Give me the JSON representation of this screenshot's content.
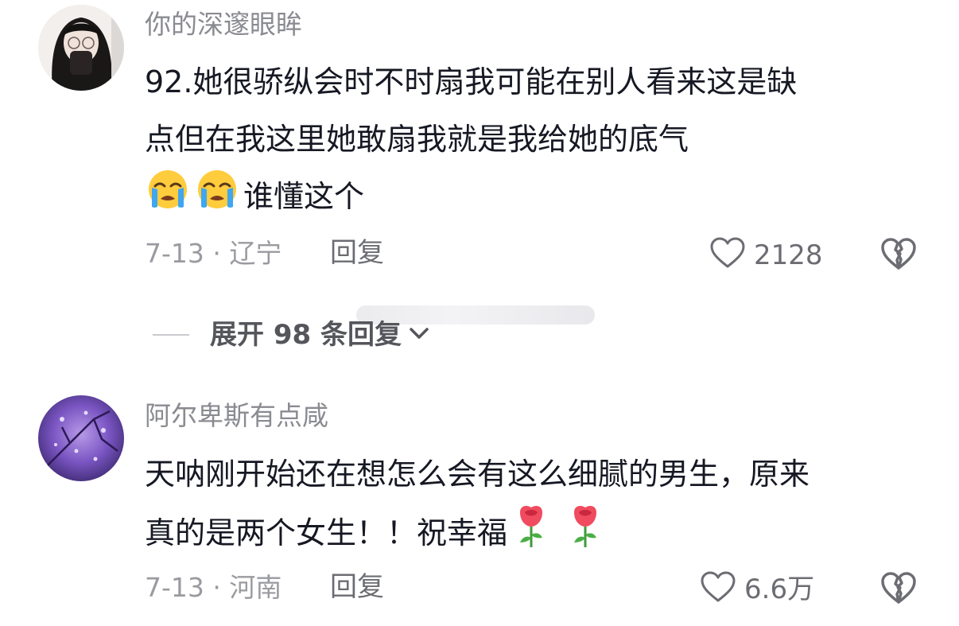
{
  "comments": [
    {
      "username": "你的深邃眼眸",
      "lines": [
        "92.她很骄纵会时不时扇我可能在别人看来这是缺",
        "点但在我这里她敢扇我就是我给她的底气"
      ],
      "emoji_line_text": "谁懂这个",
      "emoji_icons": [
        "crying-face-icon",
        "crying-face-icon"
      ],
      "date_location": "7-13 · 辽宁",
      "reply_label": "回复",
      "like_count": "2128",
      "expand_label": "展开 98 条回复"
    },
    {
      "username": "阿尔卑斯有点咸",
      "lines": [
        "天呐刚开始还在想怎么会有这么细腻的男生，原来",
        "真的是两个女生！！祝幸福"
      ],
      "emoji_icons": [
        "rose-icon",
        "rose-icon"
      ],
      "date_location": "7-13 · 河南",
      "reply_label": "回复",
      "like_count": "6.6万"
    }
  ],
  "colors": {
    "username": "#8a8b91",
    "body_text": "#161823",
    "meta": "#9a9ba0",
    "action": "#6c6d73"
  }
}
